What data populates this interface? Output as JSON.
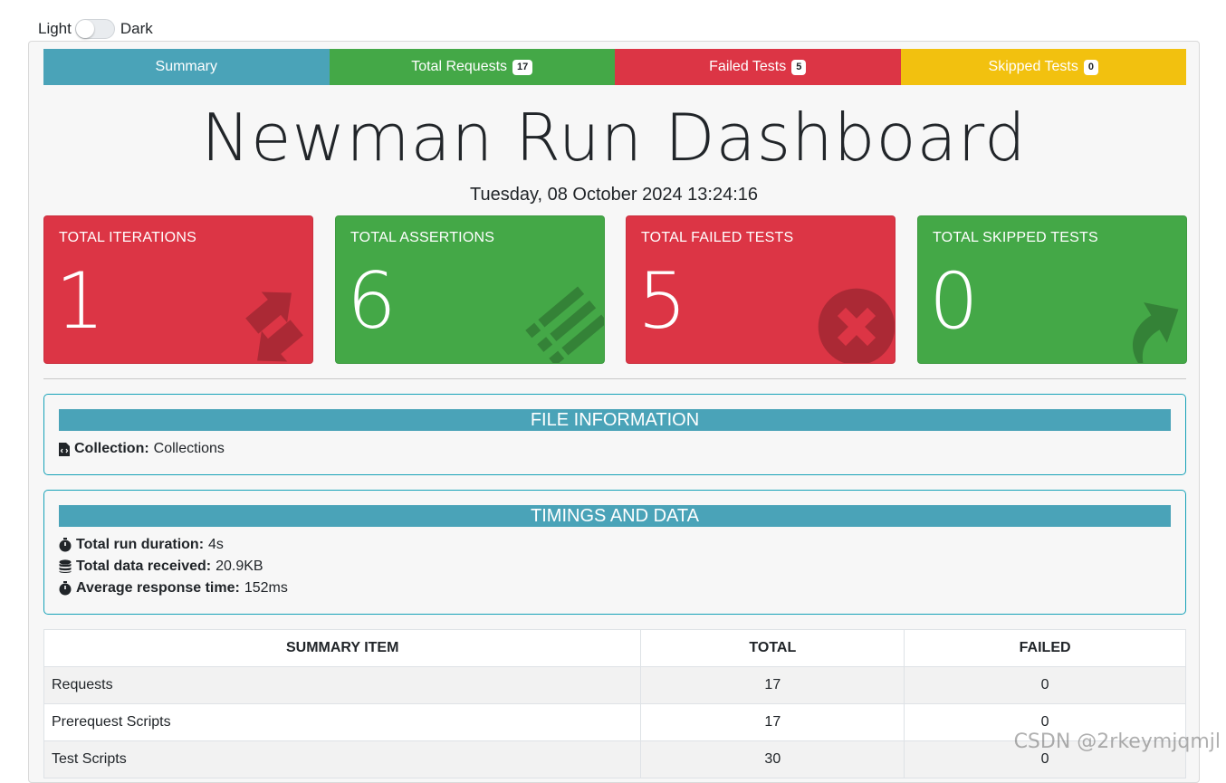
{
  "theme_toggle": {
    "light_label": "Light",
    "dark_label": "Dark"
  },
  "nav": {
    "summary": "Summary",
    "total_requests": "Total Requests",
    "total_requests_count": "17",
    "failed_tests": "Failed Tests",
    "failed_tests_count": "5",
    "skipped_tests": "Skipped Tests",
    "skipped_tests_count": "0"
  },
  "page_title": "Newman Run Dashboard",
  "timestamp": "Tuesday, 08 October 2024 13:24:16",
  "cards": [
    {
      "label": "TOTAL ITERATIONS",
      "value": "1",
      "color": "#dc3545",
      "icon": "refresh-icon"
    },
    {
      "label": "TOTAL ASSERTIONS",
      "value": "6",
      "color": "#44a847",
      "icon": "list-icon"
    },
    {
      "label": "TOTAL FAILED TESTS",
      "value": "5",
      "color": "#dc3545",
      "icon": "times-circle-icon"
    },
    {
      "label": "TOTAL SKIPPED TESTS",
      "value": "0",
      "color": "#44a847",
      "icon": "share-arrow-icon"
    }
  ],
  "file_info": {
    "heading": "FILE INFORMATION",
    "collection_label": "Collection:",
    "collection_value": "Collections"
  },
  "timings": {
    "heading": "TIMINGS AND DATA",
    "duration_label": "Total run duration:",
    "duration_value": "4s",
    "data_label": "Total data received:",
    "data_value": "20.9KB",
    "avg_label": "Average response time:",
    "avg_value": "152ms"
  },
  "summary_table": {
    "headers": [
      "SUMMARY ITEM",
      "TOTAL",
      "FAILED"
    ],
    "rows": [
      [
        "Requests",
        "17",
        "0"
      ],
      [
        "Prerequest Scripts",
        "17",
        "0"
      ],
      [
        "Test Scripts",
        "30",
        "0"
      ]
    ]
  },
  "watermark": "CSDN @2rkeymjqmjl",
  "colors": {
    "info": "#4aa3b8",
    "success": "#44a847",
    "danger": "#dc3545",
    "warning": "#f2c10f"
  }
}
